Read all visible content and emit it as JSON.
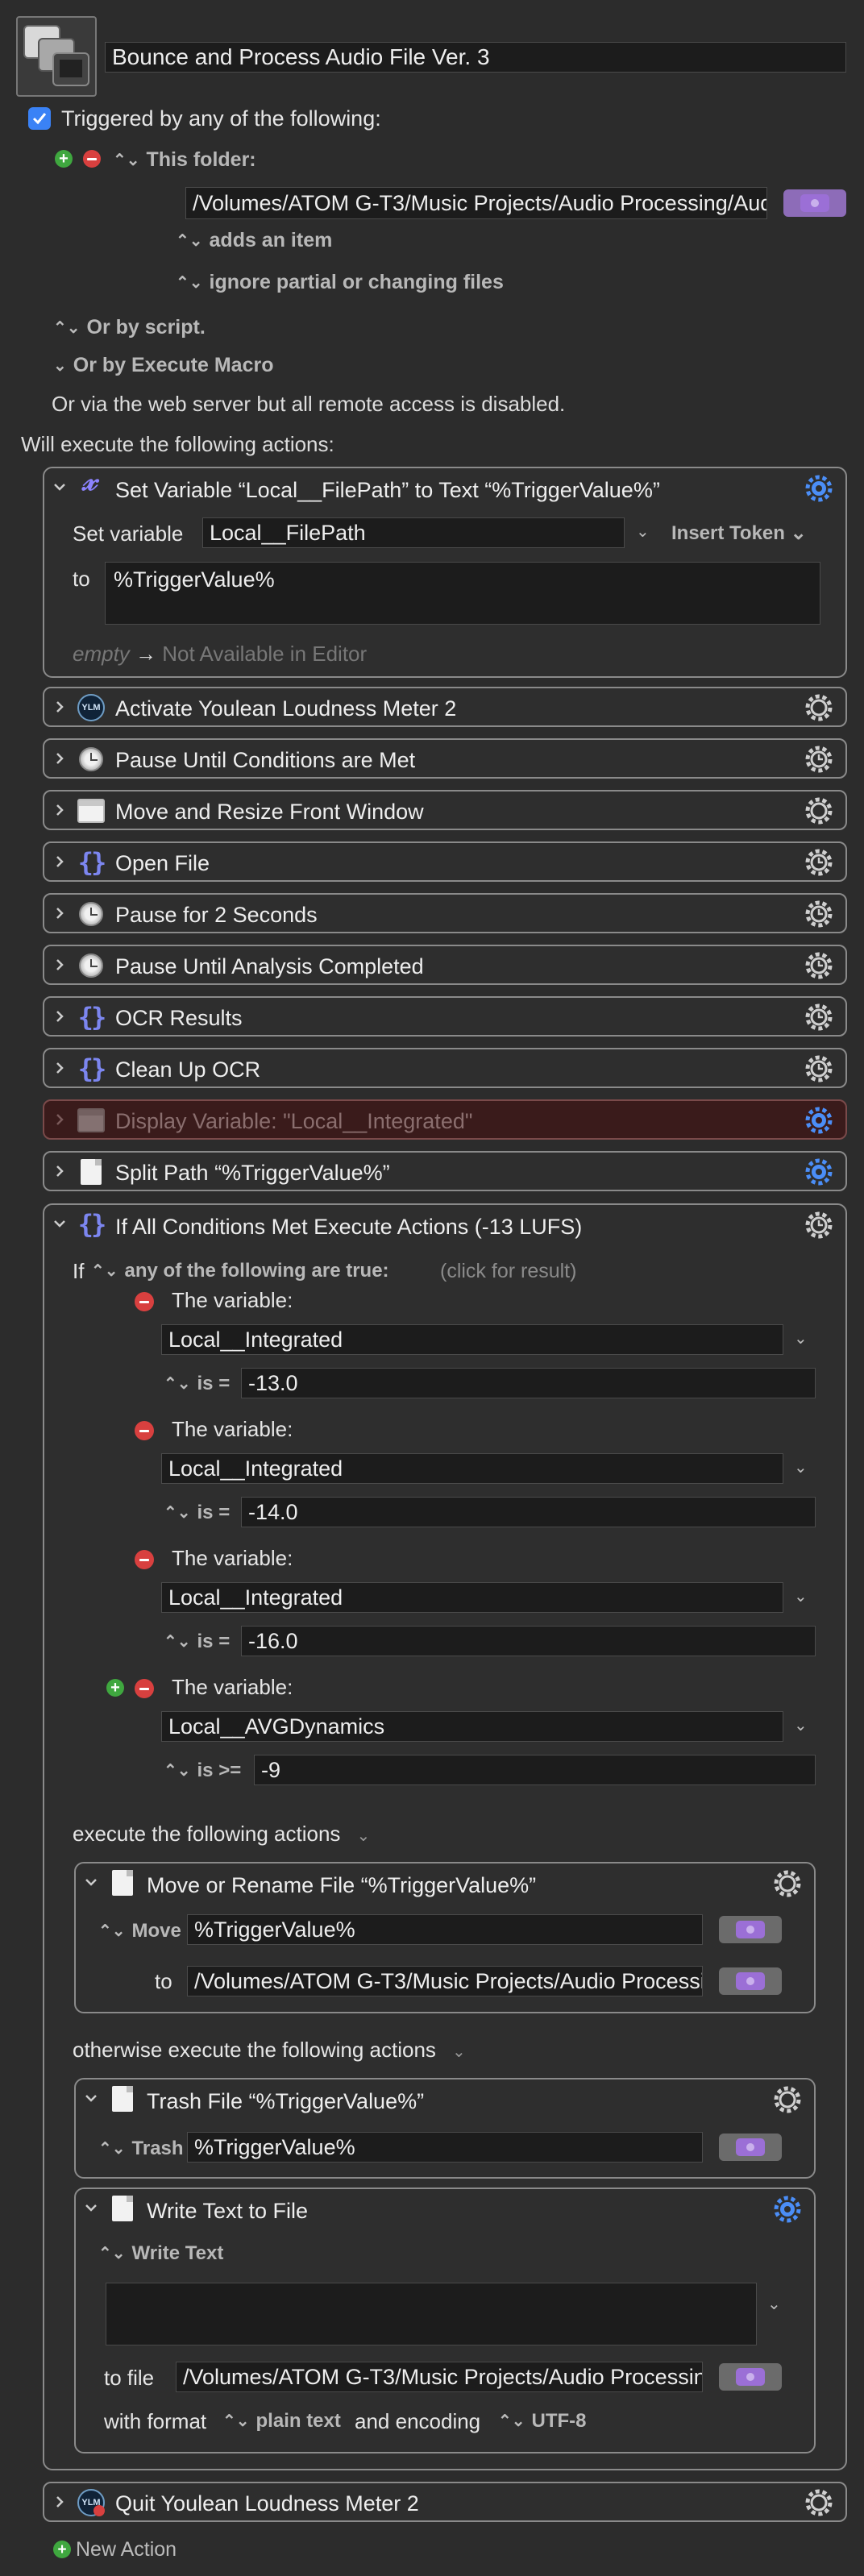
{
  "header": {
    "macro_name": "Bounce and Process Audio File Ver. 3",
    "macro_icon": "macro-stack-icon"
  },
  "triggers": {
    "checkbox_label": "Triggered by any of the following:",
    "checked": true,
    "folder_label": "This folder:",
    "folder_path": "/Volumes/ATOM G-T3/Music Projects/Audio Processing/Aud",
    "adds_item": "adds an item",
    "ignore_partial": "ignore partial or changing files",
    "or_by_script": "Or by script.",
    "or_by_execute": "Or by Execute Macro",
    "web_server": "Or via the web server but all remote access is disabled."
  },
  "actions_label": "Will execute the following actions:",
  "set_variable": {
    "title": "Set Variable “Local__FilePath” to Text “%TriggerValue%”",
    "set_label": "Set variable",
    "var_name": "Local__FilePath",
    "insert_token": "Insert Token",
    "to_label": "to",
    "value": "%TriggerValue%",
    "empty_label": "empty",
    "arrow": "→",
    "not_available": "Not Available in Editor"
  },
  "collapsed_actions": [
    {
      "title": "Activate Youlean Loudness Meter 2",
      "icon": "ylm-icon",
      "gear": "gear-icon"
    },
    {
      "title": "Pause Until Conditions are Met",
      "icon": "clock-icon",
      "gear": "timer-gear-icon"
    },
    {
      "title": "Move and Resize Front Window",
      "icon": "window-icon",
      "gear": "gear-icon"
    },
    {
      "title": "Open File",
      "icon": "curly-braces-icon",
      "gear": "timer-gear-icon"
    },
    {
      "title": "Pause for 2 Seconds",
      "icon": "clock-icon",
      "gear": "timer-gear-icon"
    },
    {
      "title": "Pause Until Analysis Completed",
      "icon": "clock-icon",
      "gear": "timer-gear-icon"
    },
    {
      "title": "OCR Results",
      "icon": "curly-braces-icon",
      "gear": "timer-gear-icon"
    },
    {
      "title": "Clean Up OCR",
      "icon": "curly-braces-icon",
      "gear": "timer-gear-icon"
    },
    {
      "title": "Display Variable: \"Local__Integrated\"",
      "icon": "window-icon",
      "gear": "gear-icon",
      "disabled": true
    },
    {
      "title": "Split Path “%TriggerValue%”",
      "icon": "document-icon",
      "gear": "gear-icon"
    }
  ],
  "if_action": {
    "title": "If All Conditions Met Execute Actions (-13 LUFS)",
    "if_label": "If",
    "any_label": "any of the following are true:",
    "click_result": "(click for result)",
    "conditions": [
      {
        "label": "The variable:",
        "var": "Local__Integrated",
        "op": "is =",
        "value": "-13.0"
      },
      {
        "label": "The variable:",
        "var": "Local__Integrated",
        "op": "is =",
        "value": "-14.0"
      },
      {
        "label": "The variable:",
        "var": "Local__Integrated",
        "op": "is =",
        "value": "-16.0"
      },
      {
        "label": "The variable:",
        "var": "Local__AVGDynamics",
        "op": "is >=",
        "value": "-9"
      }
    ],
    "execute_label": "execute the following actions",
    "otherwise_label": "otherwise execute the following actions"
  },
  "move_file": {
    "title": "Move or Rename File “%TriggerValue%”",
    "move_label": "Move",
    "source": "%TriggerValue%",
    "to_label": "to",
    "dest": "/Volumes/ATOM G-T3/Music Projects/Audio Processi"
  },
  "trash_file": {
    "title": "Trash File “%TriggerValue%”",
    "trash_label": "Trash",
    "source": "%TriggerValue%"
  },
  "write_text": {
    "title": "Write Text to File",
    "write_label": "Write Text",
    "text": "",
    "to_file_label": "to file",
    "path": "/Volumes/ATOM G-T3/Music Projects/Audio Processin",
    "with_format": "with format",
    "format": "plain text",
    "and_encoding": "and encoding",
    "encoding": "UTF-8"
  },
  "quit_action": {
    "title": "Quit Youlean Loudness Meter 2"
  },
  "footer": {
    "new_action": "New Action"
  },
  "colors": {
    "accent": "#4b8ef7",
    "disabled_bg": "#3a1b1b",
    "token_purple": "#9b6fd6",
    "minus_red": "#d8403f",
    "plus_green": "#3fa73f"
  }
}
